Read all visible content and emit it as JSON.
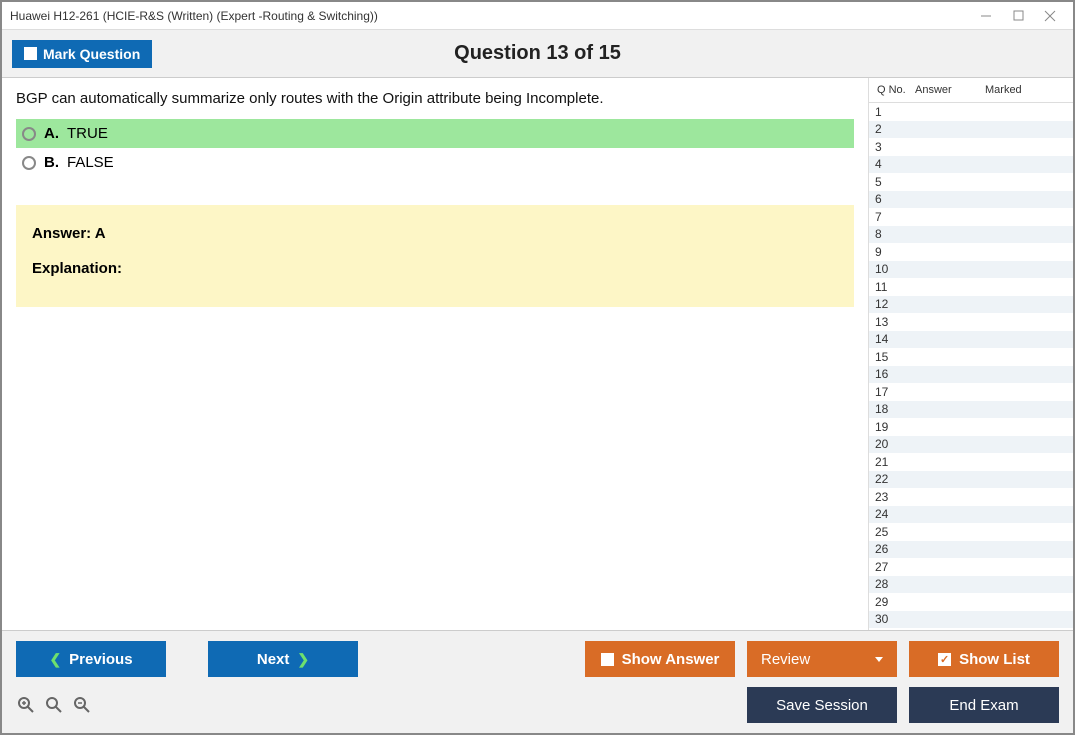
{
  "titlebar": {
    "title": "Huawei H12-261 (HCIE-R&S (Written) (Expert -Routing & Switching))"
  },
  "header": {
    "mark_label": "Mark Question",
    "counter": "Question 13 of 15"
  },
  "question": {
    "text": "BGP can automatically summarize only routes with the Origin attribute being Incomplete.",
    "options": [
      {
        "letter": "A.",
        "text": "TRUE",
        "correct": true
      },
      {
        "letter": "B.",
        "text": "FALSE",
        "correct": false
      }
    ],
    "answer_label": "Answer: A",
    "explanation_label": "Explanation:"
  },
  "sidebar": {
    "headers": {
      "qno": "Q No.",
      "answer": "Answer",
      "marked": "Marked"
    },
    "rows": [
      {
        "n": "1"
      },
      {
        "n": "2"
      },
      {
        "n": "3"
      },
      {
        "n": "4"
      },
      {
        "n": "5"
      },
      {
        "n": "6"
      },
      {
        "n": "7"
      },
      {
        "n": "8"
      },
      {
        "n": "9"
      },
      {
        "n": "10"
      },
      {
        "n": "11"
      },
      {
        "n": "12"
      },
      {
        "n": "13"
      },
      {
        "n": "14"
      },
      {
        "n": "15"
      },
      {
        "n": "16"
      },
      {
        "n": "17"
      },
      {
        "n": "18"
      },
      {
        "n": "19"
      },
      {
        "n": "20"
      },
      {
        "n": "21"
      },
      {
        "n": "22"
      },
      {
        "n": "23"
      },
      {
        "n": "24"
      },
      {
        "n": "25"
      },
      {
        "n": "26"
      },
      {
        "n": "27"
      },
      {
        "n": "28"
      },
      {
        "n": "29"
      },
      {
        "n": "30"
      }
    ]
  },
  "footer": {
    "previous": "Previous",
    "next": "Next",
    "show_answer": "Show Answer",
    "review": "Review",
    "show_list": "Show List",
    "save_session": "Save Session",
    "end_exam": "End Exam"
  }
}
